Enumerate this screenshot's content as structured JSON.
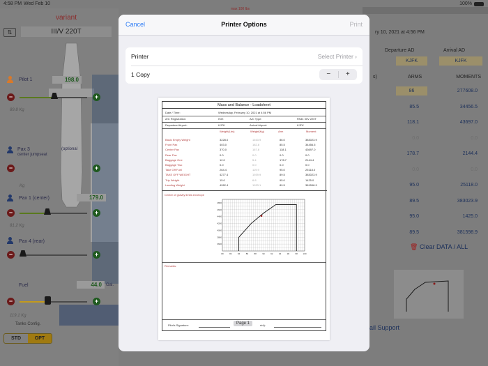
{
  "status_bar": {
    "time": "4:58 PM",
    "date": "Wed Feb 10",
    "battery": "100%"
  },
  "left": {
    "variant_label": "variant",
    "variant_value": "III/V 220T",
    "pilot1": {
      "label": "Pilot 1",
      "value": "198.0",
      "kg": "89.8 Kg"
    },
    "pax3": {
      "label": "Pax 3",
      "sub": "center jumpseat",
      "optional": "(optional"
    },
    "pax1": {
      "label": "Pax 1 (center)",
      "value": "179.0",
      "kg": "81.2 Kg"
    },
    "pax4": {
      "label": "Pax 4 (rear)"
    },
    "fuel": {
      "label": "Fuel",
      "value": "44.0",
      "unit": "Gal.",
      "kg": "119.1 Kg"
    },
    "kg_small": "Kg",
    "tanks_label": "Tanks Config.",
    "tank_options": [
      "STD",
      "OPT"
    ],
    "selected_tank": "OPT",
    "max_label": "max 100 lbs"
  },
  "right": {
    "date_text": "ry 10, 2021 at 4:56 PM",
    "col_departure": "Departure AD",
    "col_arrival": "Arrival AD",
    "departure_code": "KJFK",
    "arrival_code": "KJFK",
    "arms_header": "ARMS",
    "moments_header": "MOMENTS",
    "rows": [
      {
        "arm": "86",
        "moment": "277608.0",
        "arm_boxed": true
      },
      {
        "arm": "85.5",
        "moment": "34456.5"
      },
      {
        "arm": "118.1",
        "moment": "43697.0"
      },
      {
        "arm": "0.0",
        "moment": "0.0",
        "muted": true
      },
      {
        "arm": "178.7",
        "moment": "2144.4"
      },
      {
        "arm": "0.0",
        "moment": "0.0",
        "muted": true
      },
      {
        "arm": "95.0",
        "moment": "25118.0"
      },
      {
        "arm": "89.5",
        "moment": "383023.9"
      },
      {
        "arm": "95.0",
        "moment": "1425.0"
      },
      {
        "arm": "89.5",
        "moment": "381598.9"
      }
    ],
    "clear_label": "Clear DATA / ALL",
    "support_label": "ail Support"
  },
  "modal": {
    "cancel": "Cancel",
    "title": "Printer Options",
    "print": "Print",
    "printer_label": "Printer",
    "printer_value": "Select Printer",
    "copies_label": "1 Copy",
    "minus": "−",
    "plus": "+",
    "page_label": "Page 1"
  },
  "sheet": {
    "title": "Mass and Balance - Loadsheet",
    "date_label": "Date / Time:",
    "date_value": "Wednesday, February 10, 2021 at 4:56 PM",
    "reg_label": "A/C Registration:",
    "reg_value": "ISIX",
    "type_label": "A/C Type:",
    "type_value": "PA34 III/V 220T",
    "dep_label": "Departure Airport:",
    "dep_value": "KJFK",
    "arr_label": "Arrival Airport:",
    "arr_value": "KJFK",
    "columns": [
      "Weight(Lbs)",
      "Weight(Kg)",
      "Arm",
      "Moment"
    ],
    "rows": [
      {
        "name": "Basic Empty Weight",
        "lbs": "3228.0",
        "kg": "1463.9",
        "arm": "86.0",
        "moment": "383023.9"
      },
      {
        "name": "Front Pax",
        "lbs": "403.0",
        "kg": "182.8",
        "arm": "85.5",
        "moment": "34456.5"
      },
      {
        "name": "Center Pax",
        "lbs": "370.0",
        "kg": "167.8",
        "arm": "118.1",
        "moment": "43697.0"
      },
      {
        "name": "Rear Pax",
        "lbs": "0.0",
        "kg": "0.0",
        "arm": "0.0",
        "moment": "0.0"
      },
      {
        "name": "Baggage One",
        "lbs": "12.0",
        "kg": "5.4",
        "arm": "178.7",
        "moment": "2144.4"
      },
      {
        "name": "Baggage Two",
        "lbs": "0.0",
        "kg": "0.0",
        "arm": "0.0",
        "moment": "0.0"
      },
      {
        "name": "Take Off Fuel",
        "lbs": "264.4",
        "kg": "119.9",
        "arm": "95.0",
        "moment": "25118.0"
      },
      {
        "name": "TAKE OFF WEIGHT",
        "lbs": "4277.4",
        "kg": "1939.9",
        "arm": "89.5",
        "moment": "383023.9"
      },
      {
        "name": "Trip Weight",
        "lbs": "15.0",
        "kg": "6.8",
        "arm": "95.0",
        "moment": "1425.0"
      },
      {
        "name": "Landing Weight",
        "lbs": "4262.4",
        "kg": "1933.1",
        "arm": "89.5",
        "moment": "381598.9"
      }
    ],
    "cg_label": "Center of gravity limits envelope",
    "remarks_label": "Remarks:",
    "pilot_sig": "Pilot's Signature:",
    "second_sig": "rint):"
  },
  "chart_data": {
    "type": "line",
    "title": "Center of gravity limits envelope",
    "x_ticks": [
      "80",
      "82",
      "84",
      "86",
      "88",
      "90",
      "92",
      "94",
      "96",
      "98",
      "100"
    ],
    "y_ticks": [
      "3600",
      "3800",
      "4000",
      "4200",
      "4400",
      "4600",
      "4800"
    ],
    "xlim": [
      80,
      100
    ],
    "ylim": [
      3400,
      4900
    ],
    "series": [
      {
        "x": [
          84,
          84,
          87,
          90,
          93,
          98,
          98
        ],
        "y": [
          3400,
          3800,
          4200,
          4500,
          4750,
          4750,
          3400
        ]
      }
    ],
    "point": {
      "x": 89.5,
      "y": 4420
    },
    "grid": true
  }
}
